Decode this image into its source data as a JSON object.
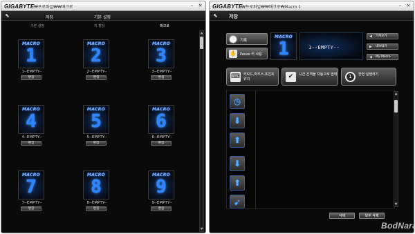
{
  "colors": {
    "accent_blue": "#2d86ff",
    "window_bg": "#0a0a0a",
    "titlebar": "#e8e8e8"
  },
  "left_window": {
    "brand": "GIGABYTE",
    "breadcrumb": "₩프로파일₩₩매크로",
    "window_buttons": {
      "minimize": "–",
      "close": "×"
    },
    "back_icon": "back-arrow-icon",
    "tabs": [
      "저장",
      "기본 설정"
    ],
    "subtabs": [
      "기본 설정",
      "키 할당",
      "매크로"
    ],
    "active_subtab": "매크로",
    "tile_word": "MACRO",
    "edit_label": "편집",
    "macros": [
      {
        "num": "1",
        "label": "1--EMPTY--"
      },
      {
        "num": "2",
        "label": "2--EMPTY--"
      },
      {
        "num": "3",
        "label": "3--EMPTY--"
      },
      {
        "num": "4",
        "label": "4--EMPTY--"
      },
      {
        "num": "5",
        "label": "5--EMPTY--"
      },
      {
        "num": "6",
        "label": "6--EMPTY--"
      },
      {
        "num": "7",
        "label": "7--EMPTY--"
      },
      {
        "num": "8",
        "label": "8--EMPTY--"
      },
      {
        "num": "9",
        "label": "9--EMPTY--"
      }
    ],
    "scroll": {
      "up": "▲",
      "down": "▼"
    }
  },
  "right_window": {
    "brand": "GIGABYTE",
    "breadcrumb": "₩프로파일₩₩매크로₩Macro 1",
    "window_buttons": {
      "minimize": "–",
      "close": "×"
    },
    "back_icon": "back-arrow-icon",
    "tab": "저장",
    "record_label": "기록",
    "pause_label": "Pause 키 사용",
    "pause_icon": "✋",
    "preview": {
      "word": "MACRO",
      "num": "1"
    },
    "macro_name": "1--EMPTY--",
    "side_buttons": [
      {
        "label": "가져오기",
        "arrow": "◀"
      },
      {
        "label": "내보내기",
        "arrow": "▶"
      },
      {
        "label": "My Macro",
        "arrow": "◀"
      }
    ],
    "big_buttons": [
      {
        "label": "키보드,마우스,포인트 위치",
        "icon": "⌨"
      },
      {
        "label": "시간 간격을 자동으로 입력",
        "icon": "✔"
      },
      {
        "label": "한번 실행하기",
        "icon": "1"
      }
    ],
    "event_icons": [
      {
        "icon": "clock-icon",
        "glyph": "◷"
      },
      {
        "icon": "key-down-icon",
        "glyph": "⬇"
      },
      {
        "icon": "key-up-icon",
        "glyph": "⬆"
      },
      {
        "icon": "key-down-icon",
        "glyph": "⬇"
      },
      {
        "icon": "key-up-icon",
        "glyph": "⬆"
      },
      {
        "icon": "mouse-icon",
        "glyph": "➹"
      }
    ],
    "scroll": {
      "up": "▲",
      "down": "▼"
    },
    "delete_label": "삭제",
    "delete_all_label": "모두 삭제"
  },
  "watermark": "BodNara"
}
